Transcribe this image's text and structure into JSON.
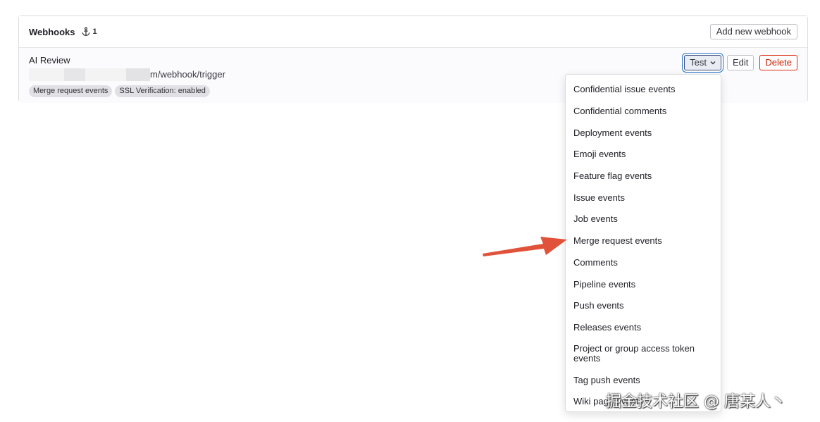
{
  "header": {
    "title": "Webhooks",
    "count": "1",
    "add_button": "Add new webhook"
  },
  "hook": {
    "name": "AI Review",
    "url_visible": "m/webhook/trigger",
    "badges": [
      "Merge request events",
      "SSL Verification: enabled"
    ],
    "test_label": "Test",
    "edit_label": "Edit",
    "delete_label": "Delete"
  },
  "dropdown": {
    "items": [
      "Confidential issue events",
      "Confidential comments",
      "Deployment events",
      "Emoji events",
      "Feature flag events",
      "Issue events",
      "Job events",
      "Merge request events",
      "Comments",
      "Pipeline events",
      "Push events",
      "Releases events",
      "Project or group access token events",
      "Tag push events",
      "Wiki page events"
    ]
  },
  "annotation": {
    "color": "#e0533a"
  },
  "watermark": "掘金技术社区 @ 唐某人丶",
  "colors": {
    "delete": "#dd2b0e",
    "focus": "#1f75cb",
    "badge_bg": "#e1e0e4"
  }
}
